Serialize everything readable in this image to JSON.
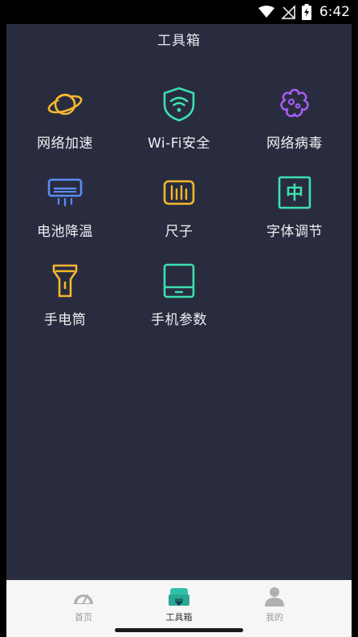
{
  "status_bar": {
    "time": "6:42"
  },
  "header": {
    "title": "工具箱"
  },
  "tools": [
    {
      "label": "网络加速",
      "icon": "planet-icon",
      "color": "#f5b82e"
    },
    {
      "label": "Wi-Fi安全",
      "icon": "wifi-shield-icon",
      "color": "#3ee0b0"
    },
    {
      "label": "网络病毒",
      "icon": "virus-icon",
      "color": "#a35cf2"
    },
    {
      "label": "电池降温",
      "icon": "air-conditioner-icon",
      "color": "#5b8cf5"
    },
    {
      "label": "尺子",
      "icon": "ruler-icon",
      "color": "#f5b82e"
    },
    {
      "label": "字体调节",
      "icon": "font-zhong-icon",
      "color": "#3ee0b0"
    },
    {
      "label": "手电筒",
      "icon": "flashlight-icon",
      "color": "#f5b82e"
    },
    {
      "label": "手机参数",
      "icon": "phone-info-icon",
      "color": "#3ee0b0"
    }
  ],
  "font_icon_char": "中",
  "tabbar": {
    "items": [
      {
        "label": "首页",
        "icon": "speedometer-icon"
      },
      {
        "label": "工具箱",
        "icon": "toolbox-icon",
        "active": true
      },
      {
        "label": "我的",
        "icon": "user-icon"
      }
    ]
  }
}
